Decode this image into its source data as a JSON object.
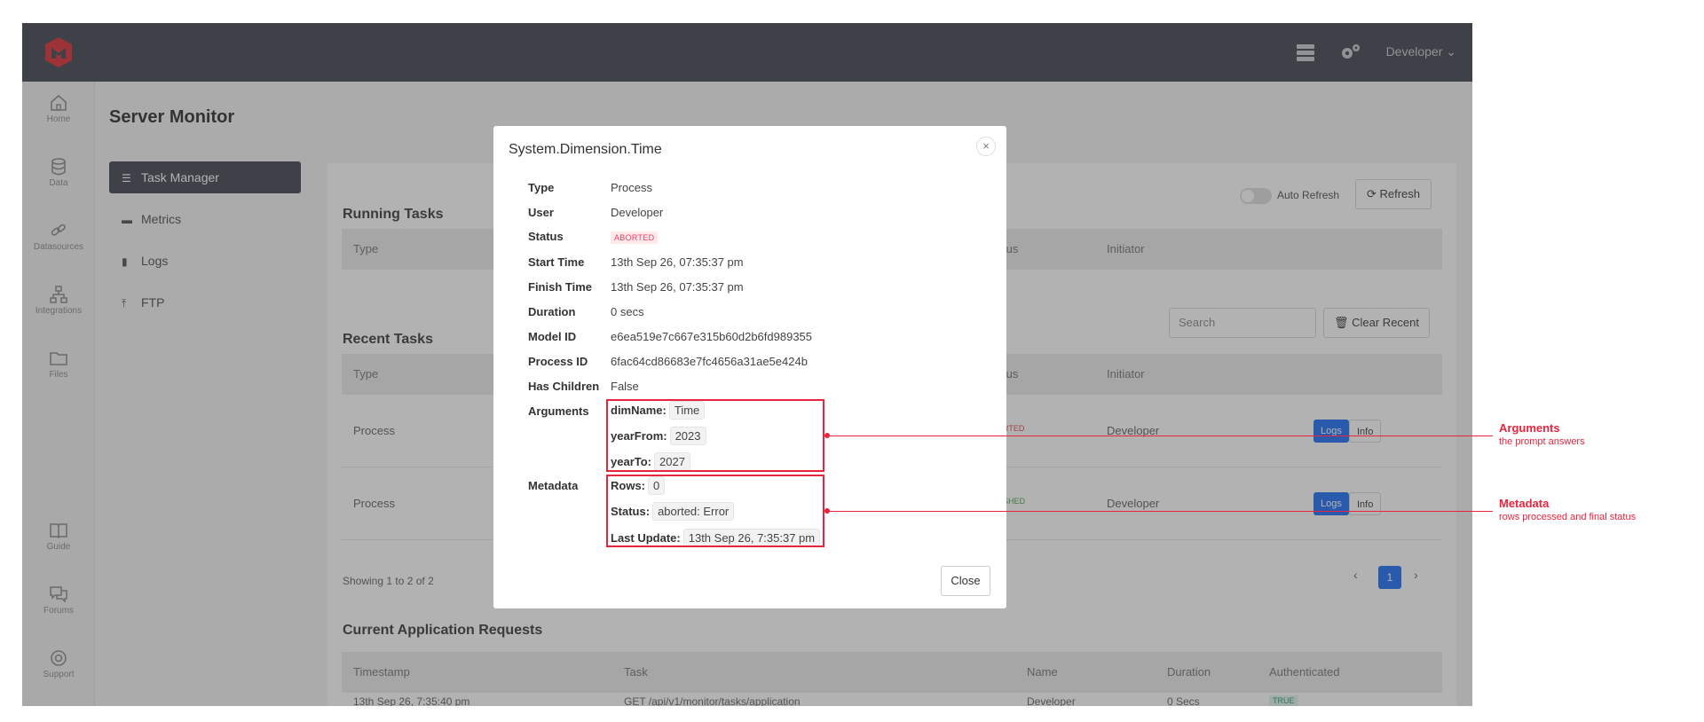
{
  "topbar": {
    "user_label": "Developer ⌄"
  },
  "nav": [
    "Home",
    "Data",
    "Datasources",
    "Integrations",
    "Files",
    "Guide",
    "Forums",
    "Support"
  ],
  "page": {
    "title": "Server Monitor"
  },
  "subnav": [
    "Task Manager",
    "Metrics",
    "Logs",
    "FTP"
  ],
  "running": {
    "title": "Running Tasks",
    "auto_refresh": "Auto Refresh",
    "refresh": "Refresh",
    "columns": {
      "type": "Type",
      "status": "tus",
      "initiator": "Initiator"
    }
  },
  "recent": {
    "title": "Recent Tasks",
    "search_placeholder": "Search",
    "clear": "Clear Recent",
    "columns": {
      "type": "Type",
      "status": "tus",
      "initiator": "Initiator"
    },
    "rows": [
      {
        "type": "Process",
        "status": "RTED",
        "initiator": "Developer",
        "logs": "Logs",
        "info": "Info"
      },
      {
        "type": "Process",
        "status": "SHED",
        "initiator": "Developer",
        "logs": "Logs",
        "info": "Info"
      }
    ],
    "showing": "Showing 1 to 2 of 2",
    "page": "1"
  },
  "requests": {
    "title": "Current Application Requests",
    "columns": {
      "timestamp": "Timestamp",
      "task": "Task",
      "name": "Name",
      "duration": "Duration",
      "auth": "Authenticated"
    },
    "row": {
      "timestamp": "13th Sep 26, 7:35:40 pm",
      "task": "GET /api/v1/monitor/tasks/application",
      "name": "Developer",
      "duration": "0 Secs",
      "auth": "TRUE"
    }
  },
  "modal": {
    "title": "System.Dimension.Time",
    "close_x": "×",
    "fields": [
      {
        "label": "Type",
        "value": "Process"
      },
      {
        "label": "User",
        "value": "Developer"
      },
      {
        "label": "Status",
        "value": "ABORTED"
      },
      {
        "label": "Start Time",
        "value": "13th Sep 26, 07:35:37 pm"
      },
      {
        "label": "Finish Time",
        "value": "13th Sep 26, 07:35:37 pm"
      },
      {
        "label": "Duration",
        "value": "0 secs"
      },
      {
        "label": "Model ID",
        "value": "e6ea519e7c667e315b60d2b6fd989355"
      },
      {
        "label": "Process ID",
        "value": "6fac64cd86683e7fc4656a31ae5e424b"
      },
      {
        "label": "Has Children",
        "value": "False"
      }
    ],
    "arguments_label": "Arguments",
    "arguments": [
      {
        "key": "dimName:",
        "value": "Time"
      },
      {
        "key": "yearFrom:",
        "value": "2023"
      },
      {
        "key": "yearTo:",
        "value": "2027"
      }
    ],
    "metadata_label": "Metadata",
    "metadata": [
      {
        "key": "Rows:",
        "value": "0"
      },
      {
        "key": "Status:",
        "value": "aborted: Error"
      },
      {
        "key": "Last Update:",
        "value": "13th Sep 26, 7:35:37 pm"
      }
    ],
    "close_button": "Close"
  },
  "annotations": [
    {
      "title": "Arguments",
      "subtitle": "the prompt answers"
    },
    {
      "title": "Metadata",
      "subtitle": "rows processed and final status"
    }
  ],
  "colors": {
    "accent": "#e8243f",
    "topbar": "#5a5d67",
    "badge_bg": "#fde8ec"
  }
}
